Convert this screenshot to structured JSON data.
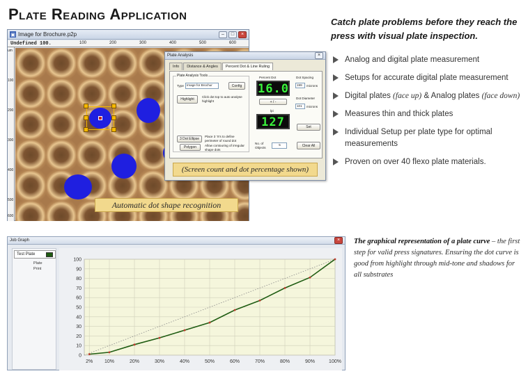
{
  "page": {
    "title": "Plate Reading Application"
  },
  "image_window": {
    "title": "Image for Brochure.p2p",
    "ruler_label": "Undefined  100.",
    "ruler_top_ticks": [
      "100",
      "200",
      "300",
      "400",
      "500",
      "600"
    ],
    "ruler_left_unit": "um",
    "ruler_left_ticks": [
      "100",
      "200",
      "300",
      "400",
      "500",
      "600"
    ],
    "caption": "Automatic dot shape recognition"
  },
  "analysis_window": {
    "title": "Plate Analysis",
    "tabs": [
      "Info",
      "Distance & Angles",
      "Percent Dot & Line Ruling"
    ],
    "active_tab_index": 2,
    "tools_group": "Plate Analysis Tools",
    "type_label": "Type",
    "type_value": "Image for Brochur",
    "config_button": "Config",
    "highlight_button": "Highlight",
    "highlight_help": "Click dot top to auto analyse highlight",
    "three_dot_button": "3 Dot Ellipse",
    "three_dot_help": "Place 3 'X's to define perimeter of round dot",
    "polygon_button": "Polygon",
    "polygon_help": "Allow contouring of irregular shape dots",
    "percent_dot_label": "Percent Dot",
    "percent_dot_value": "16.0",
    "plus_minus_button": "+ / -",
    "lpi_label": "lpi",
    "lpi_value": "127",
    "dot_spacing_label": "Dot Spacing",
    "dot_spacing_value": "199",
    "dot_spacing_unit": "microns",
    "dot_diameter_label": "Dot Diameter",
    "dot_diameter_value": "101",
    "dot_diameter_unit": "microns",
    "set_button": "Set",
    "num_objects_label": "No. of Objects",
    "num_objects_value": "5",
    "clear_all_button": "Clear All",
    "caption": "(Screen count and dot percentage shown)"
  },
  "marketing": {
    "tagline": "Catch plate problems before they reach the press with visual plate inspection.",
    "features": [
      [
        "Analog and digital plate measurement"
      ],
      [
        "Setups for accurate digital plate measurement"
      ],
      [
        "Digital plates ",
        "(face up)",
        " & Analog plates ",
        "(face down)"
      ],
      [
        "Measures thin and thick plates"
      ],
      [
        "Individual Setup per plate type for optimal measurements"
      ],
      [
        "Proven on over 40 flexo plate materials."
      ]
    ],
    "graph_caption_bold": "The graphical representation of a plate curve",
    "graph_caption_rest": " – the first step for valid press signatures. Ensuring the dot curve is good from highlight through mid-tone and shadows for all substrates"
  },
  "job_graph_window": {
    "title": "Job Graph",
    "legend_name": "Test Plate",
    "legend_color": "#1f5c12",
    "legend_sub_plate": "Plate",
    "legend_sub_print": "Print"
  },
  "chart_data": {
    "type": "line",
    "x": [
      2,
      10,
      20,
      30,
      40,
      50,
      60,
      70,
      80,
      90,
      100
    ],
    "x_tick_labels": [
      "2%",
      "10%",
      "20%",
      "30%",
      "40%",
      "50%",
      "60%",
      "70%",
      "80%",
      "90%",
      "100%"
    ],
    "y_ticks": [
      0,
      10,
      20,
      30,
      40,
      50,
      60,
      70,
      80,
      90,
      100
    ],
    "ylim": [
      0,
      100
    ],
    "xlim": [
      0,
      100
    ],
    "series": [
      {
        "name": "Test Plate",
        "color": "#1f5c12",
        "values": [
          1,
          3,
          11,
          18,
          26,
          34,
          47,
          57,
          70,
          81,
          100
        ]
      }
    ],
    "reference_line": {
      "x": [
        0,
        100
      ],
      "values": [
        0,
        100
      ],
      "color": "#888888",
      "style": "dotted"
    },
    "grid": true,
    "background": "#f5f6dc"
  }
}
